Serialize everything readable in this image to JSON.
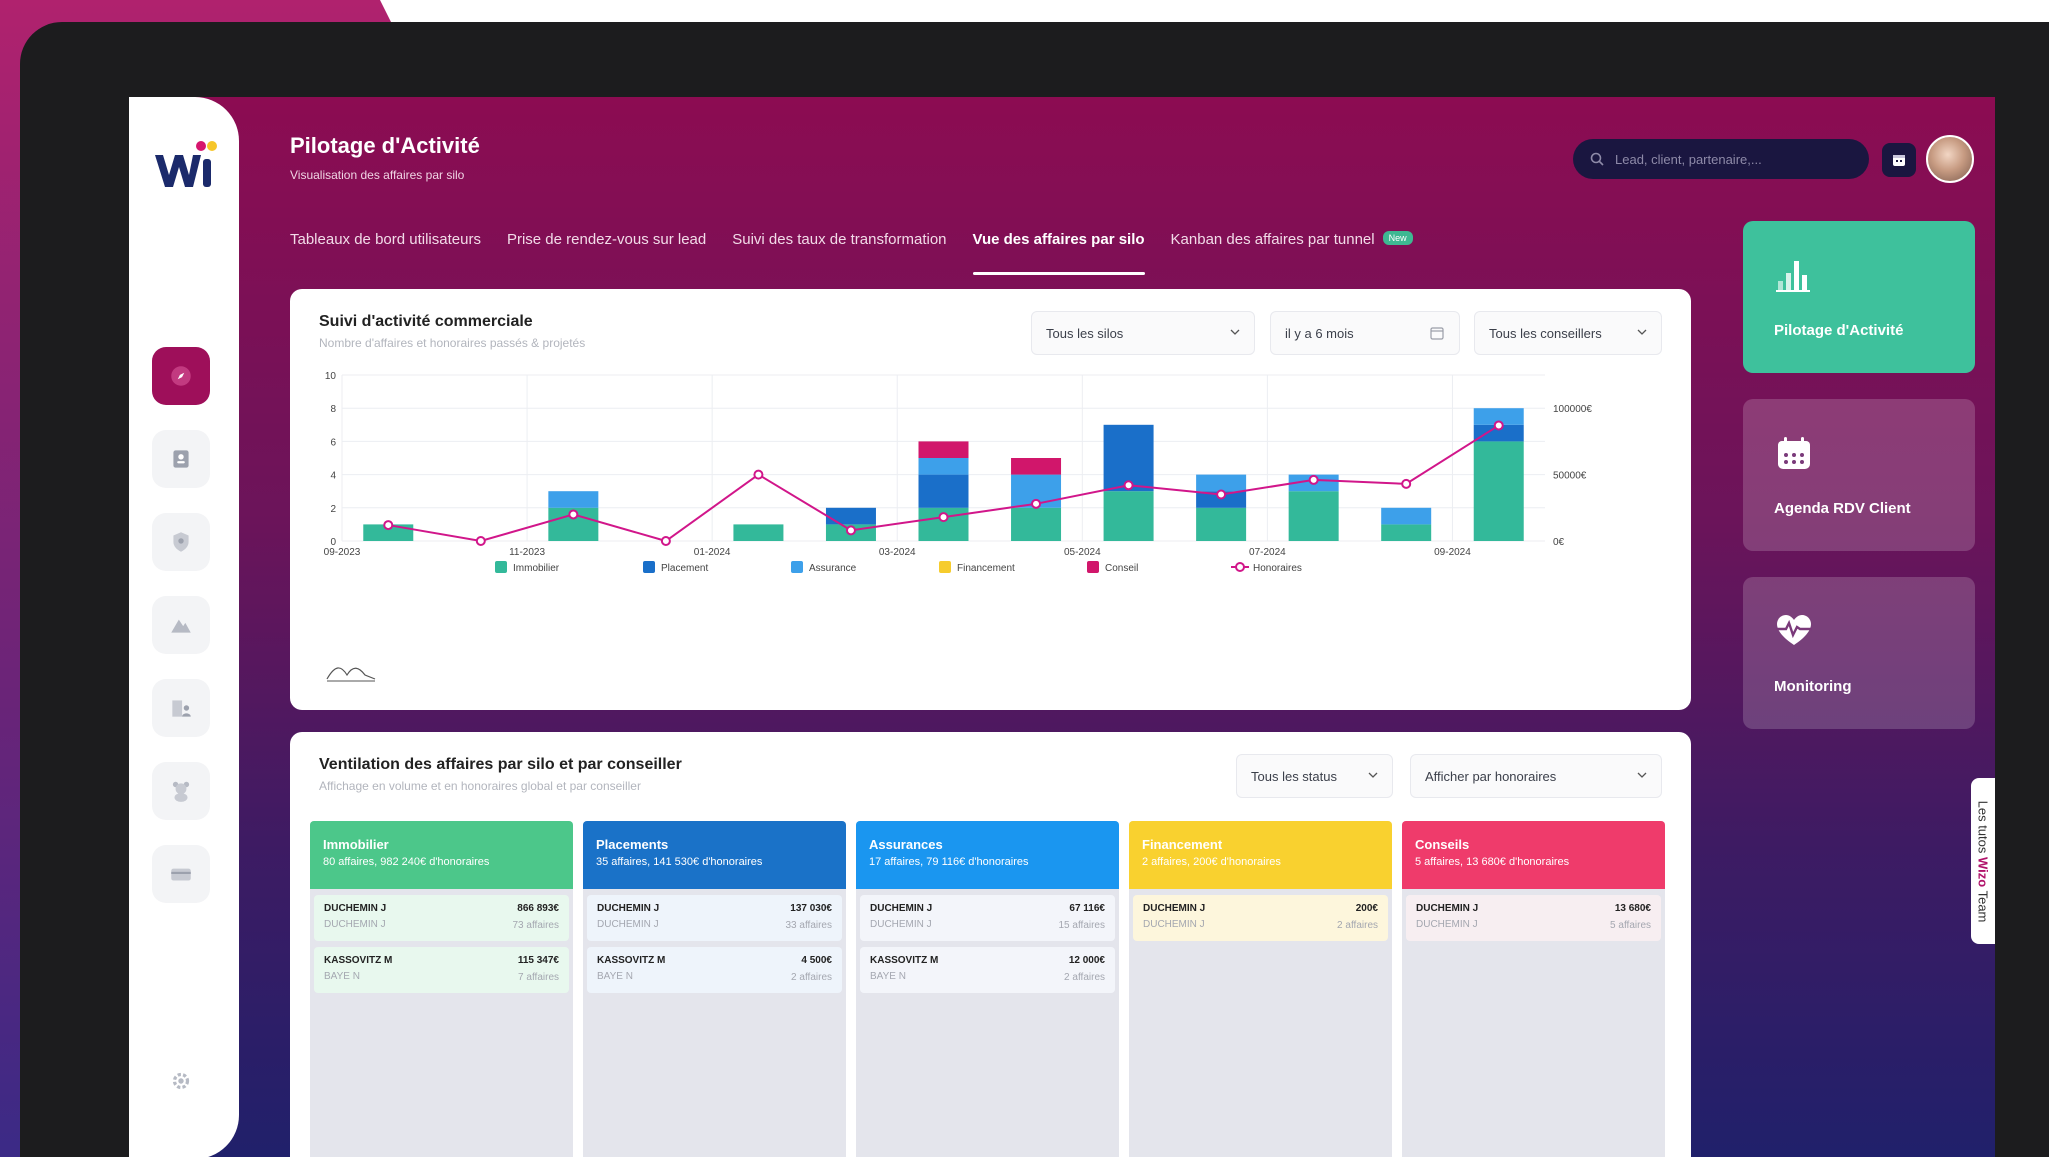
{
  "header": {
    "title": "Pilotage d'Activité",
    "subtitle": "Visualisation des affaires par silo"
  },
  "search": {
    "placeholder": "Lead, client, partenaire,..."
  },
  "tabs": [
    {
      "label": "Tableaux de bord utilisateurs"
    },
    {
      "label": "Prise de rendez-vous sur lead"
    },
    {
      "label": "Suivi des taux de transformation"
    },
    {
      "label": "Vue des affaires par silo",
      "active": true
    },
    {
      "label": "Kanban des affaires par tunnel",
      "badge": "New"
    }
  ],
  "card1": {
    "title": "Suivi d'activité commerciale",
    "subtitle": "Nombre d'affaires et honoraires passés & projetés",
    "filter_silo": "Tous les silos",
    "filter_period": "il y a 6 mois",
    "filter_advisor": "Tous les conseillers"
  },
  "chart_data": {
    "type": "bar",
    "stacked": true,
    "categories": [
      "09-2023",
      "10-2023",
      "11-2023",
      "12-2023",
      "01-2024",
      "02-2024",
      "03-2024",
      "04-2024",
      "05-2024",
      "06-2024",
      "07-2024",
      "08-2024",
      "09-2024"
    ],
    "x_tick_labels": [
      "09-2023",
      "11-2023",
      "01-2024",
      "03-2024",
      "05-2024",
      "07-2024",
      "09-2024"
    ],
    "y_ticks": [
      0,
      2,
      4,
      6,
      8,
      10
    ],
    "y2_ticks": [
      "0€",
      "50000€",
      "100000€"
    ],
    "ylim": [
      0,
      10
    ],
    "y2lim": [
      0,
      125000
    ],
    "series": [
      {
        "name": "Immobilier",
        "color": "#33b99a",
        "values": [
          1,
          0,
          2,
          0,
          1,
          1,
          2,
          2,
          3,
          2,
          3,
          1,
          6
        ]
      },
      {
        "name": "Placement",
        "color": "#1a6fc9",
        "values": [
          0,
          0,
          0,
          0,
          0,
          1,
          2,
          0,
          4,
          1,
          0,
          0,
          1
        ]
      },
      {
        "name": "Assurance",
        "color": "#3da0ea",
        "values": [
          0,
          0,
          1,
          0,
          0,
          0,
          1,
          2,
          0,
          1,
          1,
          1,
          1
        ]
      },
      {
        "name": "Financement",
        "color": "#f6cc2e",
        "values": [
          0,
          0,
          0,
          0,
          0,
          0,
          0,
          0,
          0,
          0,
          0,
          0,
          0
        ]
      },
      {
        "name": "Conseil",
        "color": "#d1166b",
        "values": [
          0,
          0,
          0,
          0,
          0,
          0,
          1,
          1,
          0,
          0,
          0,
          0,
          0
        ]
      }
    ],
    "line": {
      "name": "Honoraires",
      "color": "#d1168a",
      "values": [
        12000,
        0,
        20000,
        0,
        50000,
        8000,
        18000,
        28000,
        42000,
        35000,
        46000,
        43000,
        87000
      ]
    },
    "legend_position": "bottom"
  },
  "card2": {
    "title": "Ventilation des affaires par silo et par conseiller",
    "subtitle": "Affichage en volume et en honoraires global et par conseiller",
    "filter_status": "Tous les status",
    "filter_display": "Afficher par honoraires"
  },
  "columns": [
    {
      "title": "Immobilier",
      "summary": "80 affaires, 982 240€ d'honoraires",
      "color": "#4cc78a",
      "row_bg": "#e8f8ee",
      "rows": [
        {
          "name": "DUCHEMIN J",
          "sub": "DUCHEMIN J",
          "value": "866 893€",
          "count": "73 affaires"
        },
        {
          "name": "KASSOVITZ M",
          "sub": "BAYE N",
          "value": "115 347€",
          "count": "7 affaires"
        }
      ]
    },
    {
      "title": "Placements",
      "summary": "35 affaires, 141 530€ d'honoraires",
      "color": "#1a72c8",
      "row_bg": "#eef4fb",
      "rows": [
        {
          "name": "DUCHEMIN J",
          "sub": "DUCHEMIN J",
          "value": "137 030€",
          "count": "33 affaires"
        },
        {
          "name": "KASSOVITZ M",
          "sub": "BAYE N",
          "value": "4 500€",
          "count": "2 affaires"
        }
      ]
    },
    {
      "title": "Assurances",
      "summary": "17 affaires, 79 116€ d'honoraires",
      "color": "#1a96f0",
      "row_bg": "#f3f5fa",
      "rows": [
        {
          "name": "DUCHEMIN J",
          "sub": "DUCHEMIN J",
          "value": "67 116€",
          "count": "15 affaires"
        },
        {
          "name": "KASSOVITZ M",
          "sub": "BAYE N",
          "value": "12 000€",
          "count": "2 affaires"
        }
      ]
    },
    {
      "title": "Financement",
      "summary": "2 affaires, 200€ d'honoraires",
      "color": "#f9d12f",
      "row_bg": "#fdf6dc",
      "rows": [
        {
          "name": "DUCHEMIN J",
          "sub": "DUCHEMIN J",
          "value": "200€",
          "count": "2 affaires"
        }
      ]
    },
    {
      "title": "Conseils",
      "summary": "5 affaires, 13 680€ d'honoraires",
      "color": "#ef3b6b",
      "row_bg": "#f7eef1",
      "rows": [
        {
          "name": "DUCHEMIN J",
          "sub": "DUCHEMIN J",
          "value": "13 680€",
          "count": "5 affaires"
        }
      ]
    }
  ],
  "right_panels": [
    {
      "label": "Pilotage d'Activité",
      "icon": "bar-chart-icon",
      "color": "#3ec19c"
    },
    {
      "label": "Agenda RDV Client",
      "icon": "calendar-icon",
      "color": "rgba(255,255,255,0.18)"
    },
    {
      "label": "Monitoring",
      "icon": "heartbeat-icon",
      "color": "rgba(255,255,255,0.18)"
    }
  ],
  "tutos": {
    "prefix": "Les tutos ",
    "brand": "Wizo",
    "suffix": " Team"
  }
}
